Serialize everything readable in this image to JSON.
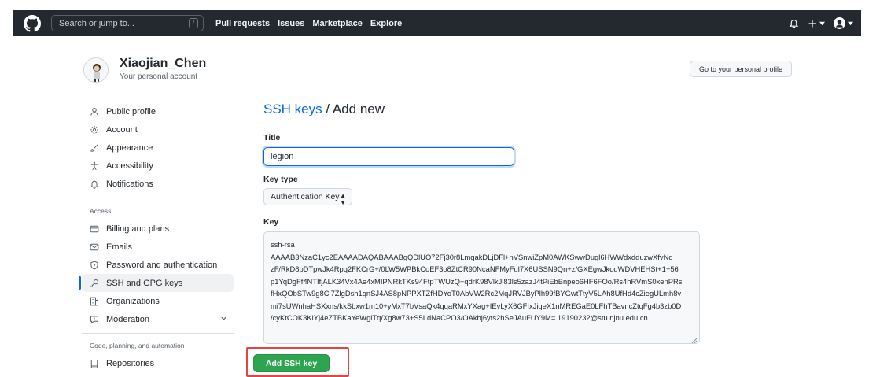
{
  "header": {
    "search_placeholder": "Search or jump to...",
    "search_shortcut": "/",
    "nav": [
      "Pull requests",
      "Issues",
      "Marketplace",
      "Explore"
    ]
  },
  "profile": {
    "name": "Xiaojian_Chen",
    "subtitle": "Your personal account",
    "go_profile_label": "Go to your personal profile"
  },
  "sidebar": {
    "items": [
      {
        "label": "Public profile",
        "icon": "person-icon"
      },
      {
        "label": "Account",
        "icon": "gear-icon"
      },
      {
        "label": "Appearance",
        "icon": "paintbrush-icon"
      },
      {
        "label": "Accessibility",
        "icon": "accessibility-icon"
      },
      {
        "label": "Notifications",
        "icon": "bell-icon"
      }
    ],
    "access_heading": "Access",
    "access_items": [
      {
        "label": "Billing and plans",
        "icon": "credit-card-icon"
      },
      {
        "label": "Emails",
        "icon": "mail-icon"
      },
      {
        "label": "Password and authentication",
        "icon": "shield-lock-icon"
      },
      {
        "label": "SSH and GPG keys",
        "icon": "key-icon"
      },
      {
        "label": "Organizations",
        "icon": "organization-icon"
      },
      {
        "label": "Moderation",
        "icon": "report-icon"
      }
    ],
    "code_heading": "Code, planning, and automation",
    "code_items": [
      {
        "label": "Repositories",
        "icon": "repo-icon"
      }
    ]
  },
  "main": {
    "title_link": "SSH keys",
    "title_rest": " / Add new",
    "title_label": "Title",
    "title_value": "legion",
    "key_type_label": "Key type",
    "key_type_value": "Authentication Key",
    "key_label": "Key",
    "key_value_lines": [
      "ssh-rsa",
      "AAAAB3NzaC1yc2EAAAADAQABAAABgQDlUO72Fj30r8LmqakDLjDFl+nVSnwiZpM0AWKSwwDugl6HWWdxdduzwXfvNq",
      "zF/RkD8bDTpwJk4Rpq2FKCrG+/0LW5WPBkCoEF3o8ZtCR90NcaNFMyFul7X6USSN9Qn+z/GXEgwJkoqWDVHEHSt+1+56",
      "p1YqDgFf4NTIfjALK34Vx4Ae4xMIPNRkTKs94FtpTWUzQ+qdrK98VlkJl83ls5zazJ4tPiEbBnpeo6HF6FOo/Rs4hRVmS0xenPRs",
      "fHxQObSTw9g8Cl7ZlgDsh1qnSJ4AS8pNPPXTZfHDYoT0AbVW2Rc2MqJRVJByPlh99fBYGwtTtyV5LAh8UfHd4cZiegULmh8v",
      "mi7sUWnhaHSXxns/kkSbxw1m10+yMxT7bVsaQk4qqaRMxYXag+IEvLyX6GFIxJiqeX1nMREGaE0LFhTBavncZtqFg4b3zb0D",
      "/cyKtCOK3KlYj4eZTBKaYeWgiTq/Xg8w73+S5LdNaCPO3/OAkbj6yts2hSeJAuFUY9M= 19190232@stu.njnu.edu.cn"
    ],
    "add_button": "Add SSH key"
  }
}
